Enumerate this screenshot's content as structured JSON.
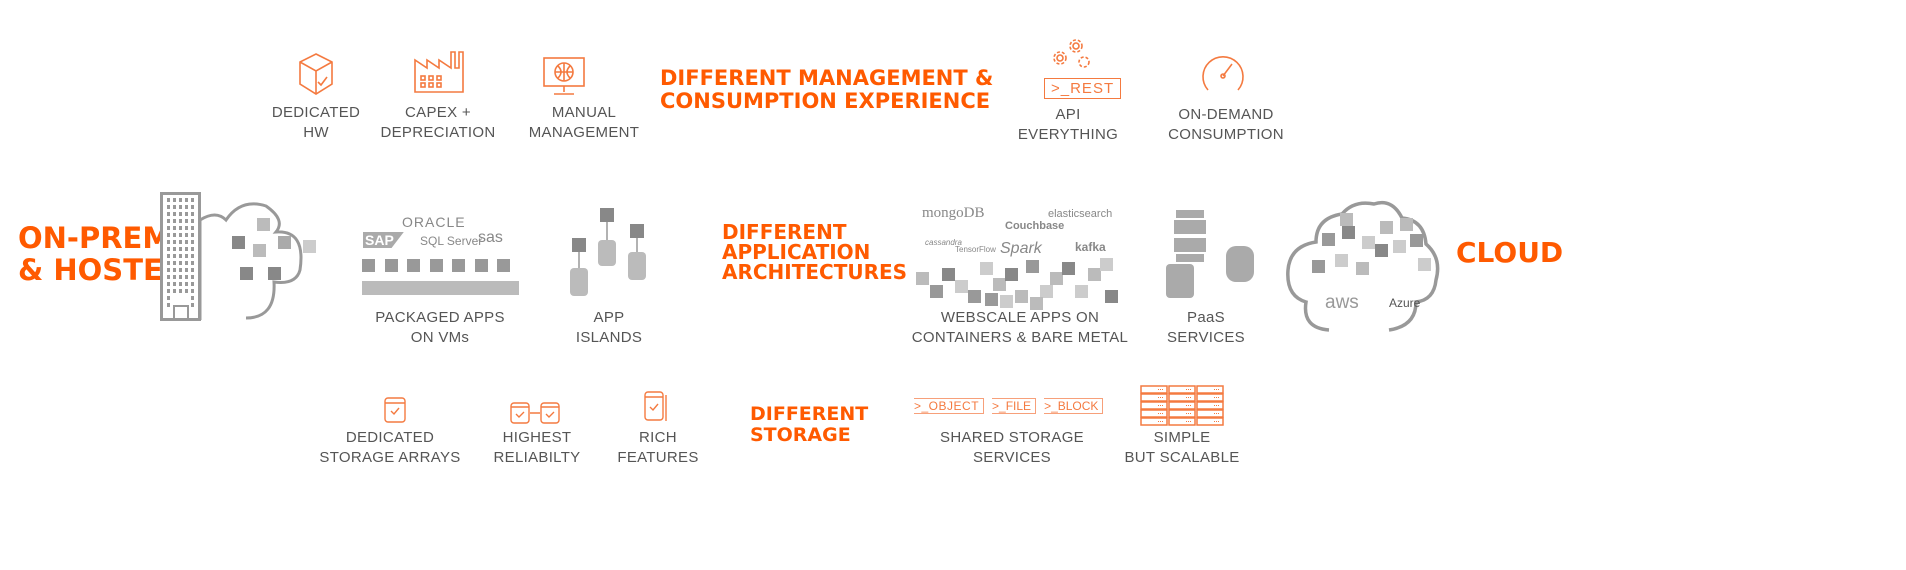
{
  "colors": {
    "accent": "#ff5a00",
    "icon": "#f47a40",
    "text": "#555555",
    "gray": "#999999"
  },
  "management": {
    "heading": [
      "DIFFERENT MANAGEMENT &",
      "CONSUMPTION EXPERIENCE"
    ],
    "onprem": [
      {
        "icon": "cube-check-icon",
        "label": [
          "DEDICATED",
          "HW"
        ]
      },
      {
        "icon": "factory-icon",
        "label": [
          "CAPEX +",
          "DEPRECIATION"
        ]
      },
      {
        "icon": "monitor-globe-icon",
        "label": [
          "MANUAL",
          "MANAGEMENT"
        ]
      }
    ],
    "cloud": [
      {
        "icon": "gears-rest-icon",
        "badge": ">_REST",
        "label": [
          "API",
          "EVERYTHING"
        ]
      },
      {
        "icon": "gauge-icon",
        "label": [
          "ON-DEMAND",
          "CONSUMPTION"
        ]
      }
    ]
  },
  "architecture": {
    "heading": [
      "DIFFERENT",
      "APPLICATION",
      "ARCHITECTURES"
    ],
    "left_title": [
      "ON-PREM",
      "& HOSTED"
    ],
    "right_title": "CLOUD",
    "packaged": {
      "logos": [
        "ORACLE",
        "SAP",
        "SQL Server",
        "sas"
      ],
      "label": [
        "PACKAGED APPS",
        "ON VMs"
      ]
    },
    "islands": {
      "label": [
        "APP",
        "ISLANDS"
      ]
    },
    "webscale": {
      "logos": [
        "mongoDB",
        "elasticsearch",
        "Couchbase",
        "cassandra",
        "TensorFlow",
        "Spark",
        "kafka"
      ],
      "label": [
        "WEBSCALE APPS ON",
        "CONTAINERS & BARE METAL"
      ]
    },
    "paas": {
      "label": [
        "PaaS",
        "SERVICES"
      ]
    },
    "cloud_logos": [
      "aws",
      "Azure"
    ]
  },
  "storage": {
    "heading": [
      "DIFFERENT",
      "STORAGE"
    ],
    "onprem": [
      {
        "icon": "storage-array-icon",
        "label": [
          "DEDICATED",
          "STORAGE ARRAYS"
        ]
      },
      {
        "icon": "replicated-storage-icon",
        "label": [
          "HIGHEST",
          "RELIABILTY"
        ]
      },
      {
        "icon": "rich-storage-icon",
        "label": [
          "RICH",
          "FEATURES"
        ]
      }
    ],
    "cloud": [
      {
        "icon": "storage-protocols-icon",
        "badges": [
          ">_OBJECT",
          ">_FILE",
          ">_BLOCK"
        ],
        "label": [
          "SHARED STORAGE",
          "SERVICES"
        ]
      },
      {
        "icon": "server-racks-icon",
        "label": [
          "SIMPLE",
          "BUT SCALABLE"
        ]
      }
    ]
  }
}
